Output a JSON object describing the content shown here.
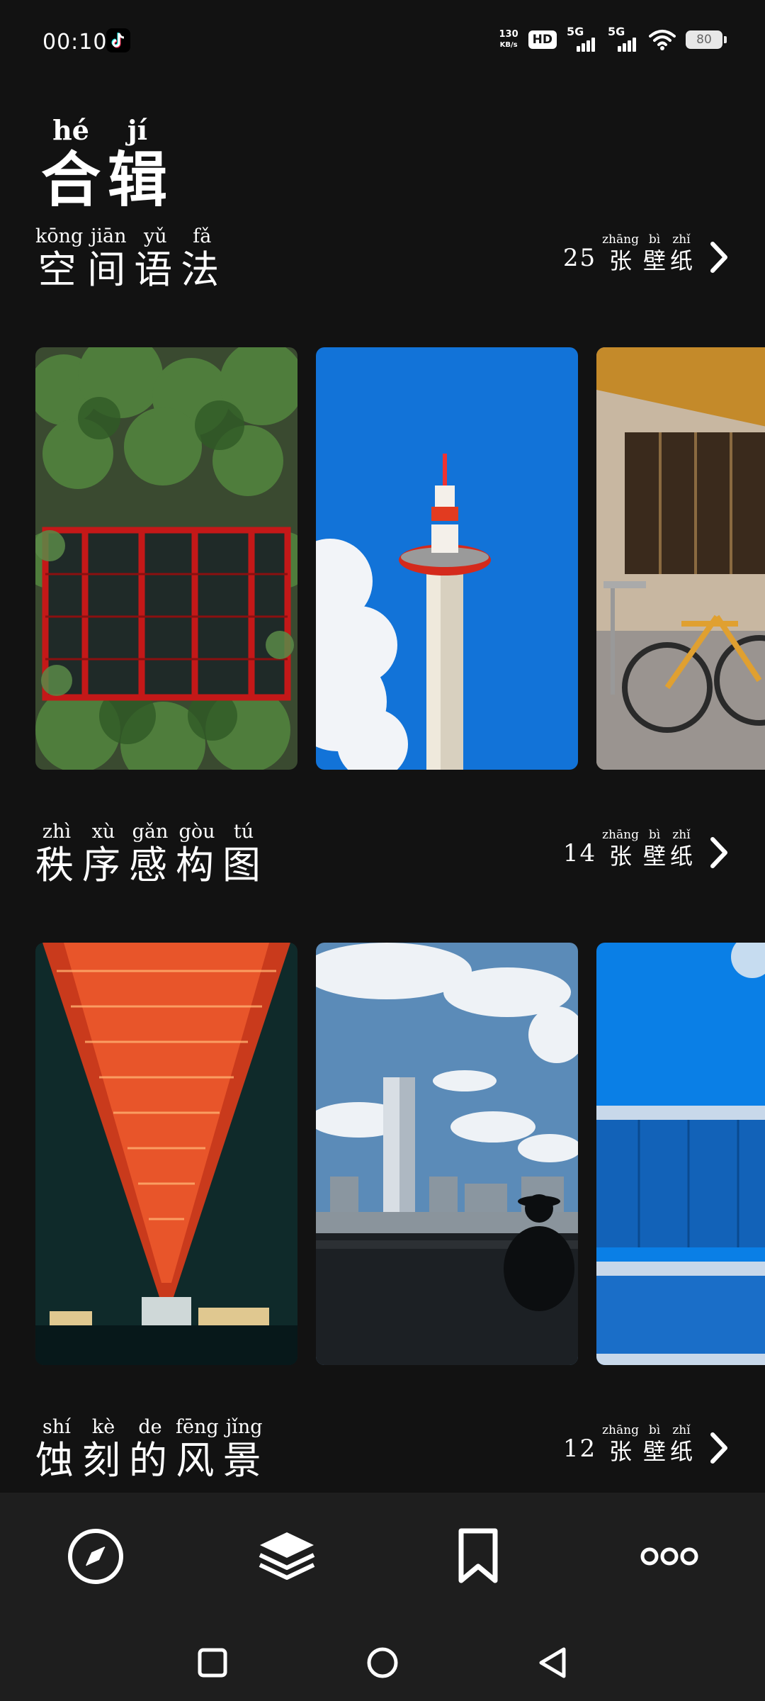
{
  "status_bar": {
    "time": "00:10",
    "net_speed_value": "130",
    "net_speed_unit": "KB/s",
    "hd_label": "HD",
    "sim1": "5G",
    "sim2": "5G",
    "battery": "80"
  },
  "page": {
    "title": [
      {
        "py": "hé",
        "hz": "合"
      },
      {
        "py": "jí",
        "hz": "辑"
      }
    ]
  },
  "collections": [
    {
      "name": [
        {
          "py": "kōng",
          "hz": "空"
        },
        {
          "py": "jiān",
          "hz": "间"
        },
        {
          "py": "yǔ",
          "hz": "语"
        },
        {
          "py": "fǎ",
          "hz": "法"
        }
      ],
      "count": "25",
      "unit": [
        {
          "py": "zhāng",
          "hz": "张"
        },
        {
          "py": "bì",
          "hz": "壁"
        },
        {
          "py": "zhǐ",
          "hz": "纸"
        }
      ],
      "thumbnails": [
        "ivy-red-window",
        "kyoto-tower-sky",
        "cafe-bicycle"
      ]
    },
    {
      "name": [
        {
          "py": "zhì",
          "hz": "秩"
        },
        {
          "py": "xù",
          "hz": "序"
        },
        {
          "py": "gǎn",
          "hz": "感"
        },
        {
          "py": "gòu",
          "hz": "构"
        },
        {
          "py": "tú",
          "hz": "图"
        }
      ],
      "count": "14",
      "unit": [
        {
          "py": "zhāng",
          "hz": "张"
        },
        {
          "py": "bì",
          "hz": "壁"
        },
        {
          "py": "zhǐ",
          "hz": "纸"
        }
      ],
      "thumbnails": [
        "red-bridge-night",
        "city-skyline-river",
        "blue-building-moon"
      ]
    },
    {
      "name": [
        {
          "py": "shí",
          "hz": "蚀"
        },
        {
          "py": "kè",
          "hz": "刻"
        },
        {
          "py": "de",
          "hz": "的"
        },
        {
          "py": "fēng",
          "hz": "风"
        },
        {
          "py": "jǐng",
          "hz": "景"
        }
      ],
      "count": "12",
      "unit": [
        {
          "py": "zhāng",
          "hz": "张"
        },
        {
          "py": "bì",
          "hz": "壁"
        },
        {
          "py": "zhǐ",
          "hz": "纸"
        }
      ]
    }
  ],
  "bottom_nav": {
    "items": [
      "compass-icon",
      "layers-icon",
      "bookmark-icon",
      "more-icon"
    ]
  },
  "system_nav": {
    "items": [
      "recents-square-icon",
      "home-circle-icon",
      "back-triangle-icon"
    ]
  }
}
